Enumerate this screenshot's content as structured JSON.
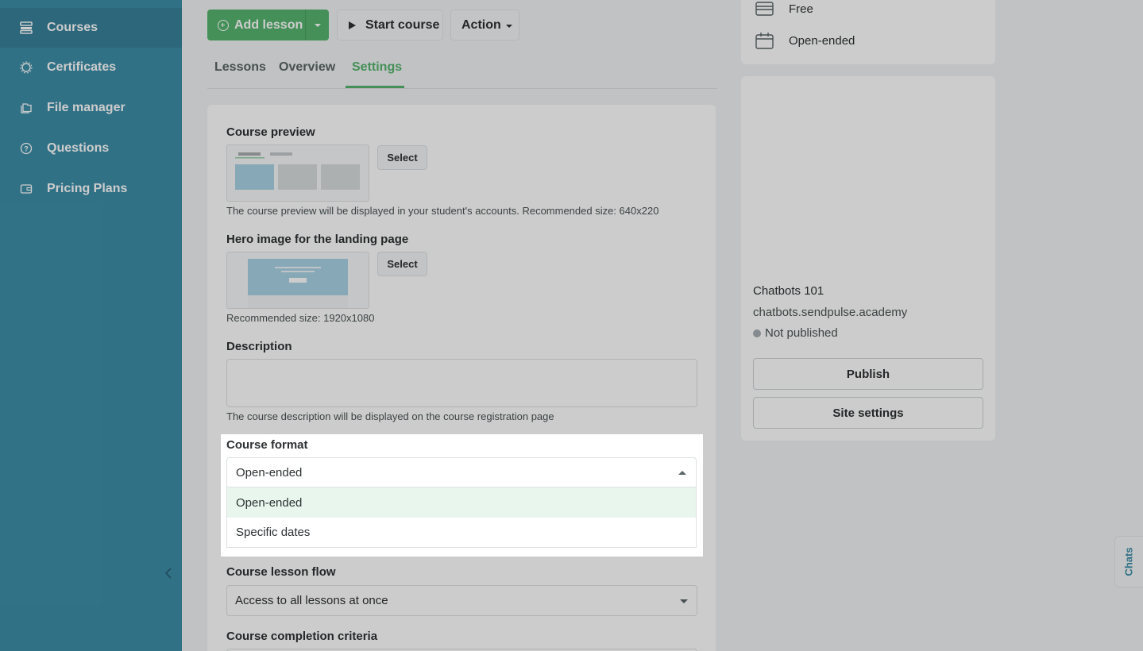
{
  "sidebar": {
    "items": [
      {
        "label": "Courses",
        "icon": "stack-icon",
        "active": true
      },
      {
        "label": "Certificates",
        "icon": "badge-icon"
      },
      {
        "label": "File manager",
        "icon": "folder-icon"
      },
      {
        "label": "Questions",
        "icon": "question-circle-icon"
      },
      {
        "label": "Pricing Plans",
        "icon": "wallet-icon"
      }
    ],
    "collapse_icon": "chevron-left-icon"
  },
  "toolbar": {
    "add_lesson": "Add lesson",
    "start_course": "Start course",
    "action": "Action"
  },
  "tabs": [
    {
      "label": "Lessons"
    },
    {
      "label": "Overview"
    },
    {
      "label": "Settings",
      "active": true
    }
  ],
  "settings": {
    "course_preview": {
      "label": "Course preview",
      "select": "Select",
      "hint": "The course preview will be displayed in your student's accounts. Recommended size: 640x220"
    },
    "hero_image": {
      "label": "Hero image for the landing page",
      "select": "Select",
      "hint": "Recommended size: 1920x1080"
    },
    "description": {
      "label": "Description",
      "value": "",
      "hint": "The course description will be displayed on the course registration page"
    },
    "course_format": {
      "label": "Course format",
      "value": "Open-ended",
      "options": [
        "Open-ended",
        "Specific dates"
      ]
    },
    "lesson_flow": {
      "label": "Course lesson flow",
      "value": "Access to all lessons at once"
    },
    "completion": {
      "label": "Course completion criteria"
    }
  },
  "summary": {
    "price": "Free",
    "format": "Open-ended",
    "site_name": "Chatbots 101",
    "site_url": "chatbots.sendpulse.academy",
    "status": "Not published",
    "publish": "Publish",
    "site_settings": "Site settings"
  },
  "chats": "Chats",
  "colors": {
    "sidebar": "#3d8ea8",
    "accent": "#56b56e",
    "hover_option": "#e8f6ee"
  }
}
